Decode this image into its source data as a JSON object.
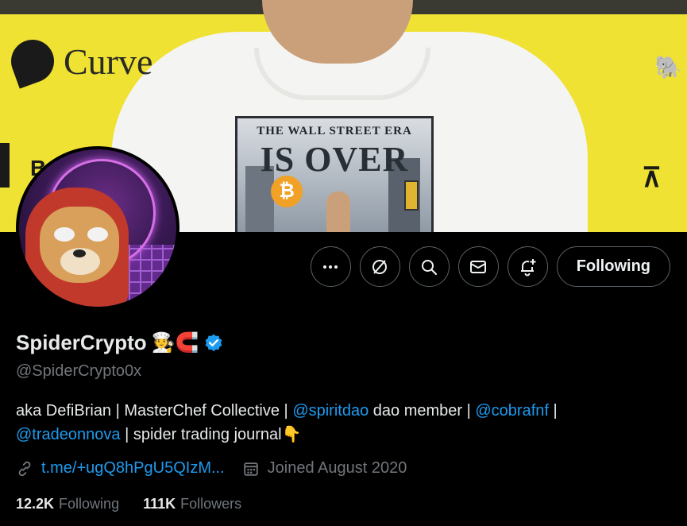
{
  "banner": {
    "logos": {
      "curve": "Curve",
      "left_letter": "B"
    },
    "book": {
      "line1": "THE WALL STREET ERA",
      "line2": "IS OVER",
      "coin": "₿"
    }
  },
  "actions": {
    "more_icon": "more-horizontal-icon",
    "grok_icon": "grok-icon",
    "search_icon": "search-icon",
    "message_icon": "envelope-icon",
    "notify_icon": "bell-plus-icon",
    "following_label": "Following"
  },
  "profile": {
    "name": "SpiderCrypto",
    "emojis": "🧑‍🍳🧲",
    "verified": true,
    "handle": "@SpiderCrypto0x",
    "bio": {
      "p1": "aka DefiBrian | MasterChef Collective | ",
      "m1": "@spiritdao",
      "p2": " dao member | ",
      "m2": "@cobrafnf",
      "p3": " |",
      "m3": "@tradeonnova",
      "p4": " | spider trading journal👇"
    },
    "link": "t.me/+ugQ8hPgU5QIzM...",
    "joined": "Joined August 2020",
    "following_count": "12.2K",
    "following_label": "Following",
    "followers_count": "111K",
    "followers_label": "Followers"
  },
  "colors": {
    "accent": "#1d9bf0",
    "muted": "#71767b",
    "text": "#e7e9ea",
    "banner": "#efe232"
  }
}
